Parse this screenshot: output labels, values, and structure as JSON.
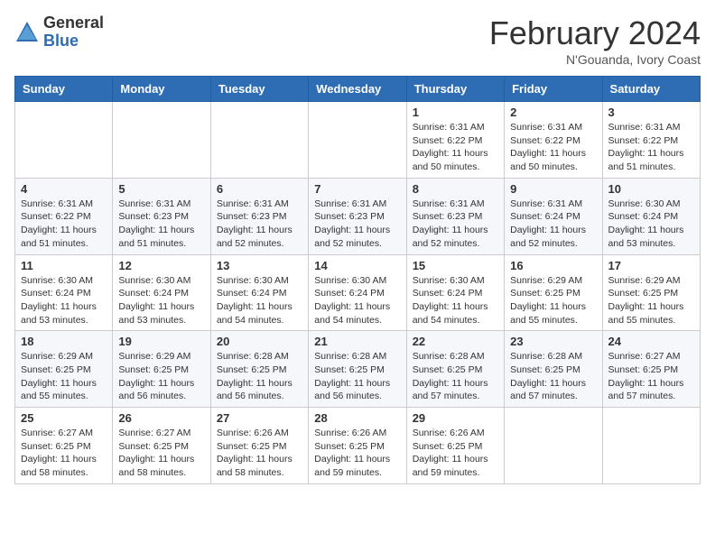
{
  "header": {
    "logo_general": "General",
    "logo_blue": "Blue",
    "title": "February 2024",
    "location": "N'Gouanda, Ivory Coast"
  },
  "days_of_week": [
    "Sunday",
    "Monday",
    "Tuesday",
    "Wednesday",
    "Thursday",
    "Friday",
    "Saturday"
  ],
  "weeks": [
    [
      {
        "day": "",
        "info": ""
      },
      {
        "day": "",
        "info": ""
      },
      {
        "day": "",
        "info": ""
      },
      {
        "day": "",
        "info": ""
      },
      {
        "day": "1",
        "info": "Sunrise: 6:31 AM\nSunset: 6:22 PM\nDaylight: 11 hours and 50 minutes."
      },
      {
        "day": "2",
        "info": "Sunrise: 6:31 AM\nSunset: 6:22 PM\nDaylight: 11 hours and 50 minutes."
      },
      {
        "day": "3",
        "info": "Sunrise: 6:31 AM\nSunset: 6:22 PM\nDaylight: 11 hours and 51 minutes."
      }
    ],
    [
      {
        "day": "4",
        "info": "Sunrise: 6:31 AM\nSunset: 6:22 PM\nDaylight: 11 hours and 51 minutes."
      },
      {
        "day": "5",
        "info": "Sunrise: 6:31 AM\nSunset: 6:23 PM\nDaylight: 11 hours and 51 minutes."
      },
      {
        "day": "6",
        "info": "Sunrise: 6:31 AM\nSunset: 6:23 PM\nDaylight: 11 hours and 52 minutes."
      },
      {
        "day": "7",
        "info": "Sunrise: 6:31 AM\nSunset: 6:23 PM\nDaylight: 11 hours and 52 minutes."
      },
      {
        "day": "8",
        "info": "Sunrise: 6:31 AM\nSunset: 6:23 PM\nDaylight: 11 hours and 52 minutes."
      },
      {
        "day": "9",
        "info": "Sunrise: 6:31 AM\nSunset: 6:24 PM\nDaylight: 11 hours and 52 minutes."
      },
      {
        "day": "10",
        "info": "Sunrise: 6:30 AM\nSunset: 6:24 PM\nDaylight: 11 hours and 53 minutes."
      }
    ],
    [
      {
        "day": "11",
        "info": "Sunrise: 6:30 AM\nSunset: 6:24 PM\nDaylight: 11 hours and 53 minutes."
      },
      {
        "day": "12",
        "info": "Sunrise: 6:30 AM\nSunset: 6:24 PM\nDaylight: 11 hours and 53 minutes."
      },
      {
        "day": "13",
        "info": "Sunrise: 6:30 AM\nSunset: 6:24 PM\nDaylight: 11 hours and 54 minutes."
      },
      {
        "day": "14",
        "info": "Sunrise: 6:30 AM\nSunset: 6:24 PM\nDaylight: 11 hours and 54 minutes."
      },
      {
        "day": "15",
        "info": "Sunrise: 6:30 AM\nSunset: 6:24 PM\nDaylight: 11 hours and 54 minutes."
      },
      {
        "day": "16",
        "info": "Sunrise: 6:29 AM\nSunset: 6:25 PM\nDaylight: 11 hours and 55 minutes."
      },
      {
        "day": "17",
        "info": "Sunrise: 6:29 AM\nSunset: 6:25 PM\nDaylight: 11 hours and 55 minutes."
      }
    ],
    [
      {
        "day": "18",
        "info": "Sunrise: 6:29 AM\nSunset: 6:25 PM\nDaylight: 11 hours and 55 minutes."
      },
      {
        "day": "19",
        "info": "Sunrise: 6:29 AM\nSunset: 6:25 PM\nDaylight: 11 hours and 56 minutes."
      },
      {
        "day": "20",
        "info": "Sunrise: 6:28 AM\nSunset: 6:25 PM\nDaylight: 11 hours and 56 minutes."
      },
      {
        "day": "21",
        "info": "Sunrise: 6:28 AM\nSunset: 6:25 PM\nDaylight: 11 hours and 56 minutes."
      },
      {
        "day": "22",
        "info": "Sunrise: 6:28 AM\nSunset: 6:25 PM\nDaylight: 11 hours and 57 minutes."
      },
      {
        "day": "23",
        "info": "Sunrise: 6:28 AM\nSunset: 6:25 PM\nDaylight: 11 hours and 57 minutes."
      },
      {
        "day": "24",
        "info": "Sunrise: 6:27 AM\nSunset: 6:25 PM\nDaylight: 11 hours and 57 minutes."
      }
    ],
    [
      {
        "day": "25",
        "info": "Sunrise: 6:27 AM\nSunset: 6:25 PM\nDaylight: 11 hours and 58 minutes."
      },
      {
        "day": "26",
        "info": "Sunrise: 6:27 AM\nSunset: 6:25 PM\nDaylight: 11 hours and 58 minutes."
      },
      {
        "day": "27",
        "info": "Sunrise: 6:26 AM\nSunset: 6:25 PM\nDaylight: 11 hours and 58 minutes."
      },
      {
        "day": "28",
        "info": "Sunrise: 6:26 AM\nSunset: 6:25 PM\nDaylight: 11 hours and 59 minutes."
      },
      {
        "day": "29",
        "info": "Sunrise: 6:26 AM\nSunset: 6:25 PM\nDaylight: 11 hours and 59 minutes."
      },
      {
        "day": "",
        "info": ""
      },
      {
        "day": "",
        "info": ""
      }
    ]
  ]
}
